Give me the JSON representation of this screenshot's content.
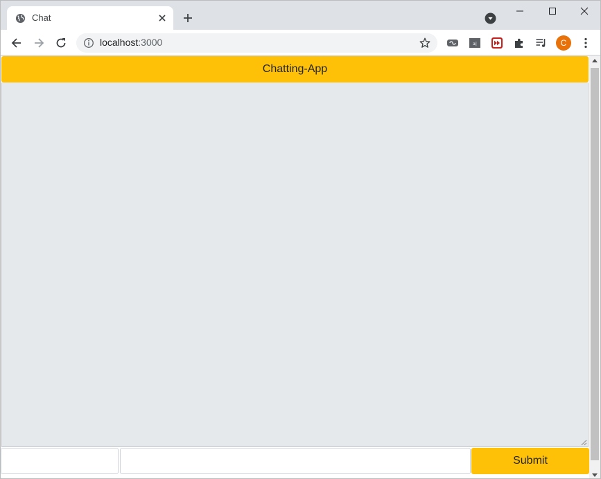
{
  "browser": {
    "tab": {
      "title": "Chat",
      "favicon": "globe-icon"
    },
    "address": {
      "host": "localhost",
      "port": ":3000"
    },
    "avatar_letter": "C",
    "colors": {
      "tabstrip": "#dee1e6",
      "avatar": "#e8710a"
    }
  },
  "app": {
    "header_title": "Chatting-App",
    "name_input": {
      "value": "",
      "placeholder": ""
    },
    "message_input": {
      "value": "",
      "placeholder": ""
    },
    "submit_label": "Submit",
    "colors": {
      "accent": "#ffc107",
      "chat_bg": "#e6e9ec"
    }
  }
}
